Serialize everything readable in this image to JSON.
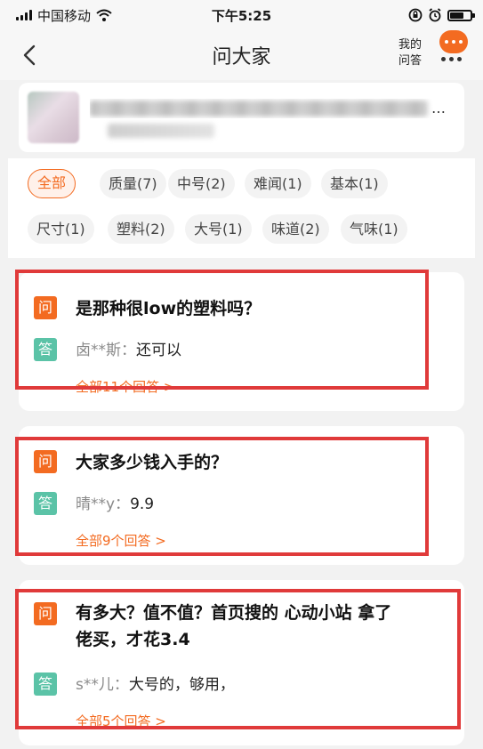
{
  "status_bar": {
    "carrier": "中国移动",
    "time": "下午5:25",
    "battery_level": 0.7
  },
  "nav": {
    "title": "问大家",
    "my_questions_line1": "我的",
    "my_questions_line2": "问答"
  },
  "product": {
    "title_visible_end": "…"
  },
  "tags": [
    {
      "label": "全部",
      "active": true
    },
    {
      "label": "质量(7)"
    },
    {
      "label": "中号(2)"
    },
    {
      "label": "难闻(1)"
    },
    {
      "label": "基本(1)"
    },
    {
      "label": "尺寸(1)"
    },
    {
      "label": "塑料(2)"
    },
    {
      "label": "大号(1)"
    },
    {
      "label": "味道(2)"
    },
    {
      "label": "气味(1)"
    }
  ],
  "qa": [
    {
      "q_badge": "问",
      "question": "是那种很low的塑料吗？",
      "a_badge": "答",
      "answer_user": "卤**斯：",
      "answer": "还可以",
      "more": "全部11个回答 >"
    },
    {
      "q_badge": "问",
      "question": "大家多少钱入手的？",
      "a_badge": "答",
      "answer_user": "晴**y：",
      "answer": "9.9",
      "more": "全部9个回答 >"
    },
    {
      "q_badge": "问",
      "question_line1": "有多大？值不值？首页搜的 心动小站 拿了",
      "question_line2": "佬买，才花3.4",
      "a_badge": "答",
      "answer_user": "s**儿：",
      "answer": "大号的，够用，",
      "more": "全部5个回答 >"
    }
  ],
  "colors": {
    "accent": "#f36b21",
    "answer_badge": "#5bc3a7",
    "highlight": "#e03a3a"
  }
}
